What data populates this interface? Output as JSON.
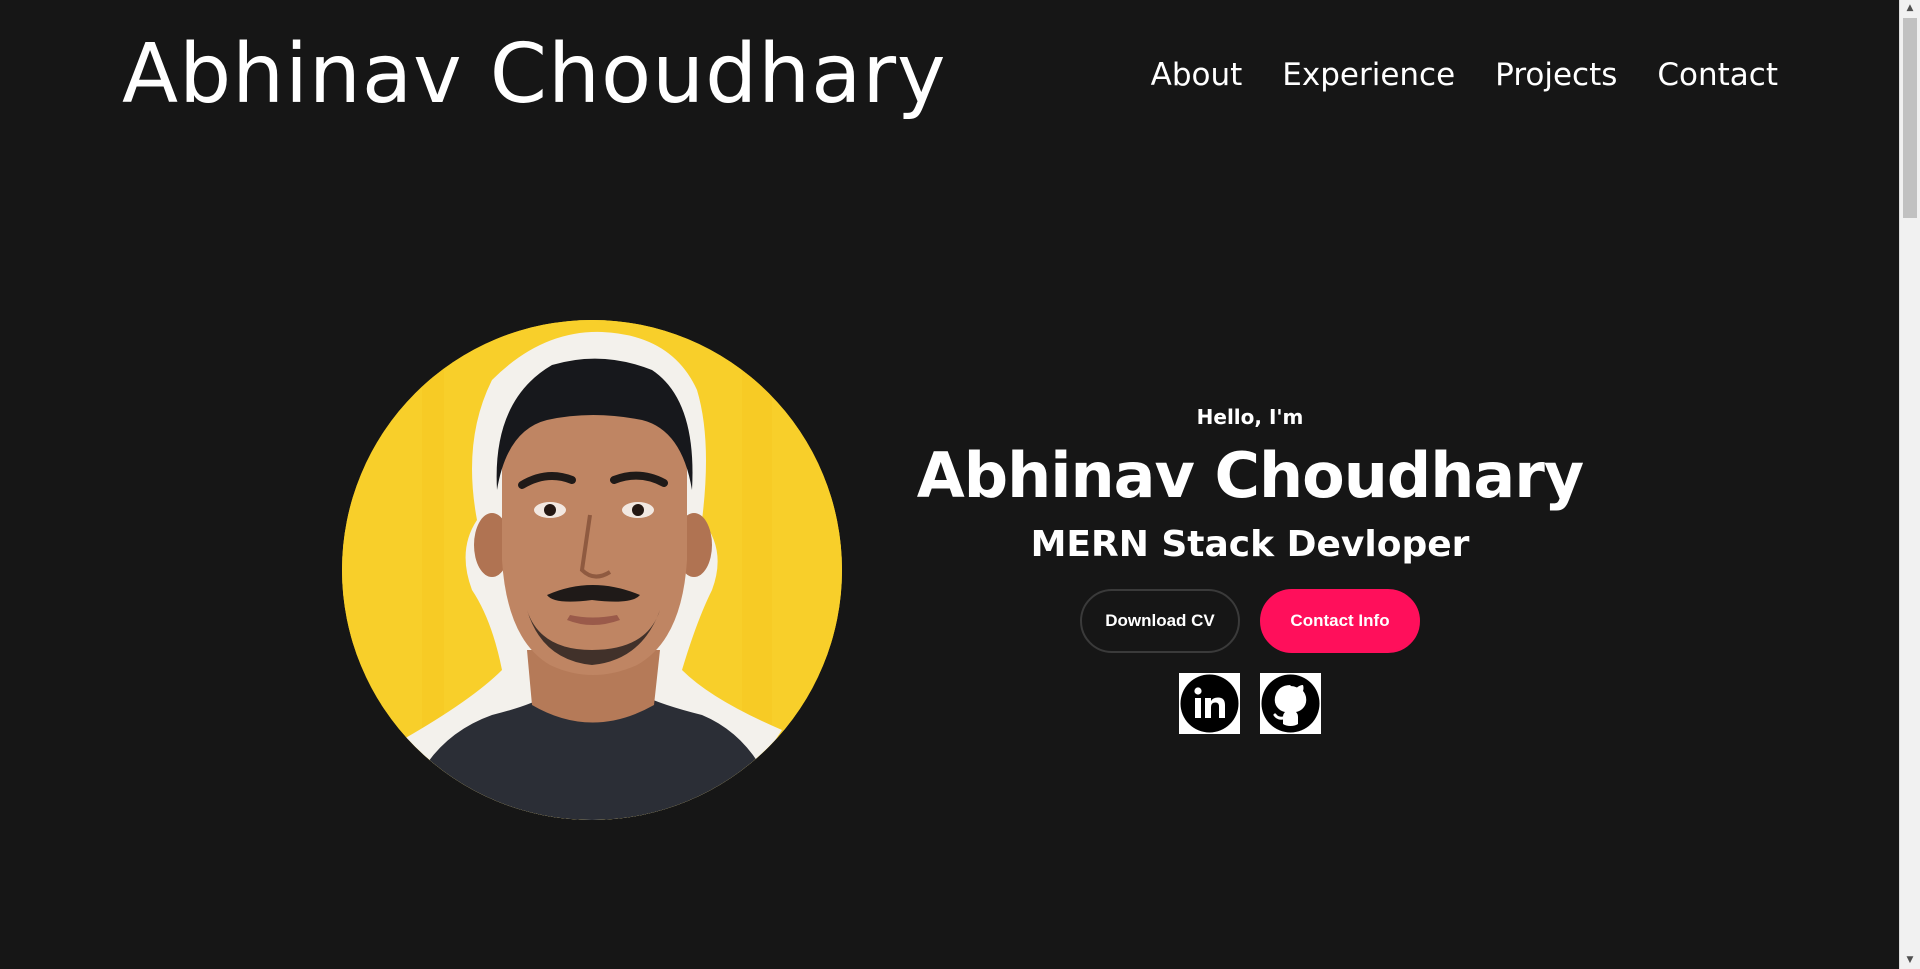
{
  "header": {
    "site_title": "Abhinav Choudhary",
    "nav": [
      {
        "label": "About"
      },
      {
        "label": "Experience"
      },
      {
        "label": "Projects"
      },
      {
        "label": "Contact"
      }
    ]
  },
  "hero": {
    "greeting": "Hello, I'm",
    "name": "Abhinav Choudhary",
    "role": "MERN Stack Devloper",
    "buttons": {
      "download_cv": "Download CV",
      "contact_info": "Contact Info"
    },
    "socials": [
      {
        "icon": "linkedin-icon"
      },
      {
        "icon": "github-icon"
      }
    ]
  },
  "colors": {
    "background": "#161616",
    "accent": "#ff0f5b",
    "profile_backdrop": "#f8cf2a"
  }
}
